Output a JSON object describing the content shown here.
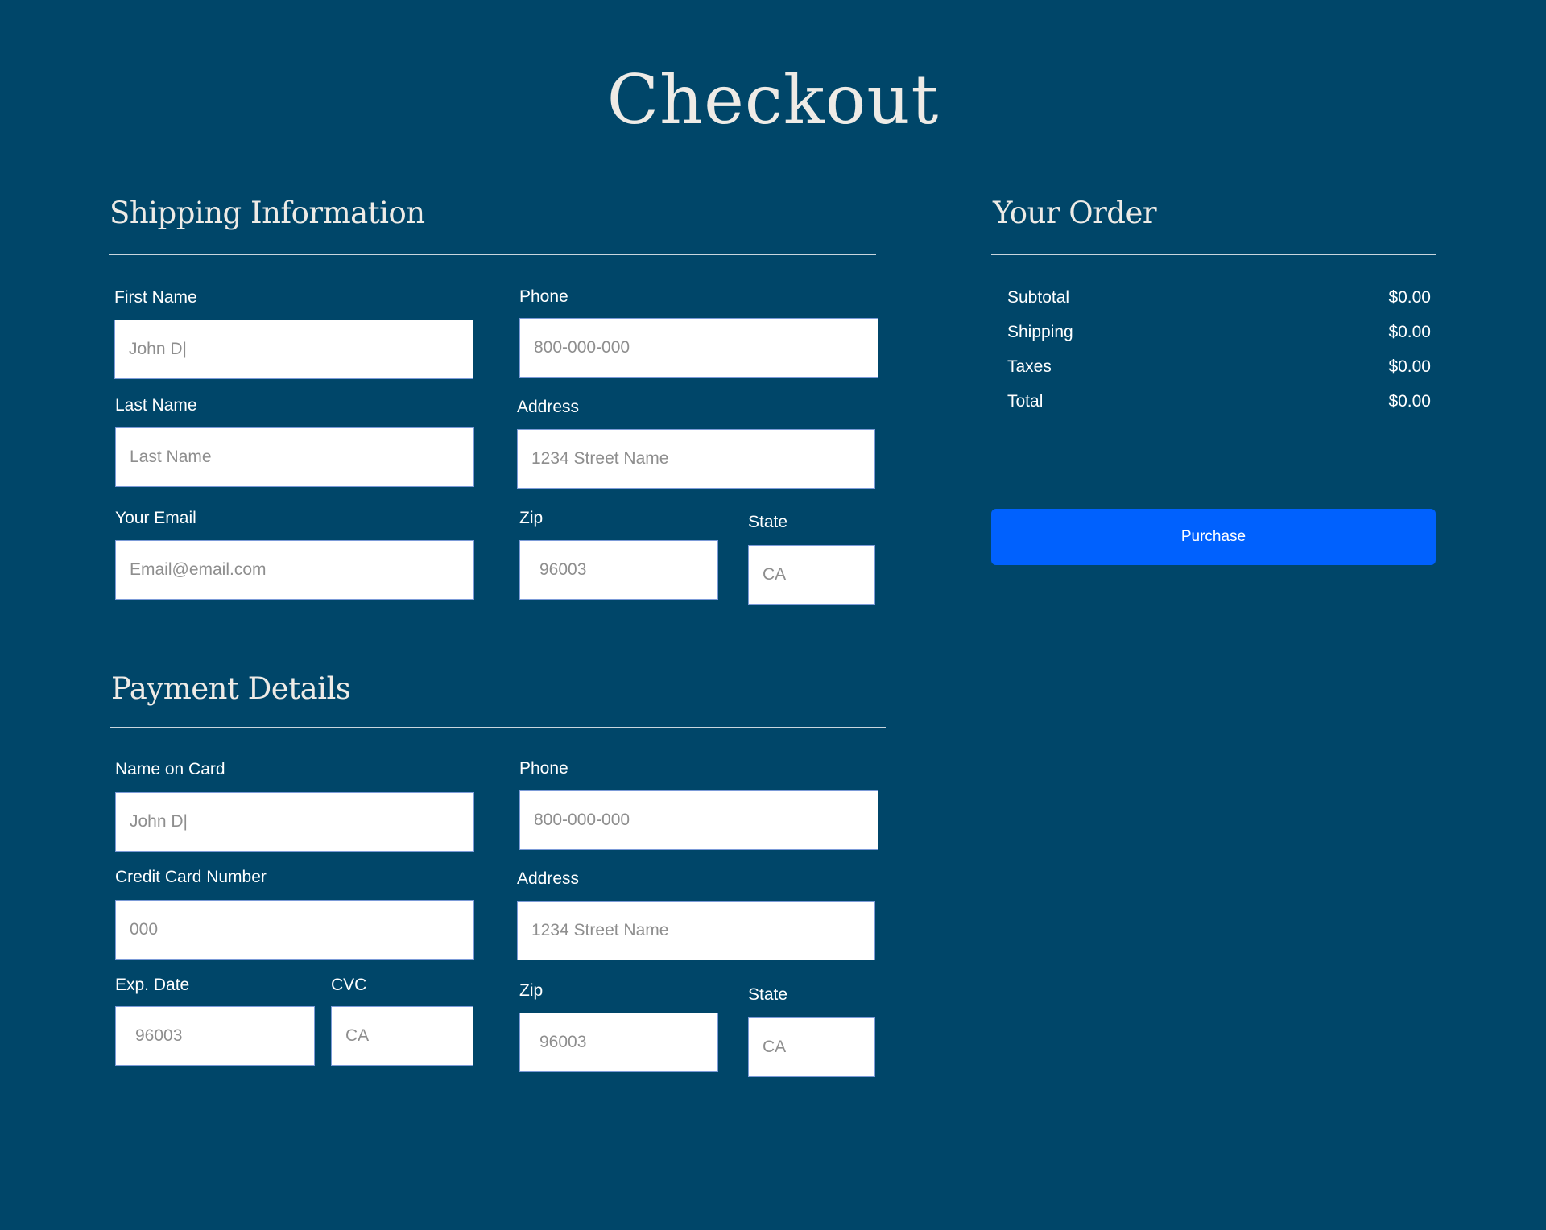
{
  "page": {
    "title": "Checkout"
  },
  "shipping": {
    "heading": "Shipping Information",
    "first_name": {
      "label": "First Name",
      "placeholder": "John D|"
    },
    "phone": {
      "label": "Phone",
      "placeholder": "800-000-000"
    },
    "last_name": {
      "label": "Last Name",
      "placeholder": "Last Name"
    },
    "address": {
      "label": "Address",
      "placeholder": "1234 Street Name"
    },
    "email": {
      "label": "Your Email",
      "placeholder": "Email@email.com"
    },
    "zip": {
      "label": "Zip",
      "placeholder": "96003"
    },
    "state": {
      "label": "State",
      "placeholder": "CA"
    }
  },
  "payment": {
    "heading": "Payment Details",
    "name_on_card": {
      "label": "Name on Card",
      "placeholder": "John D|"
    },
    "phone": {
      "label": "Phone",
      "placeholder": "800-000-000"
    },
    "card_number": {
      "label": "Credit Card Number",
      "placeholder": "000"
    },
    "address": {
      "label": "Address",
      "placeholder": "1234 Street Name"
    },
    "exp_date": {
      "label": "Exp. Date",
      "placeholder": "96003"
    },
    "cvc": {
      "label": "CVC",
      "placeholder": "CA"
    },
    "zip": {
      "label": "Zip",
      "placeholder": "96003"
    },
    "state": {
      "label": "State",
      "placeholder": "CA"
    }
  },
  "order": {
    "heading": "Your Order",
    "rows": [
      {
        "label": "Subtotal",
        "value": "$0.00"
      },
      {
        "label": "Shipping",
        "value": "$0.00"
      },
      {
        "label": "Taxes",
        "value": "$0.00"
      },
      {
        "label": "Total",
        "value": "$0.00"
      }
    ],
    "purchase_label": "Purchase"
  },
  "colors": {
    "background": "#004669",
    "heading_text": "#eeebe6",
    "button": "#0061fe",
    "field_border": "#7c9bd8",
    "placeholder": "#8e8e8e"
  }
}
